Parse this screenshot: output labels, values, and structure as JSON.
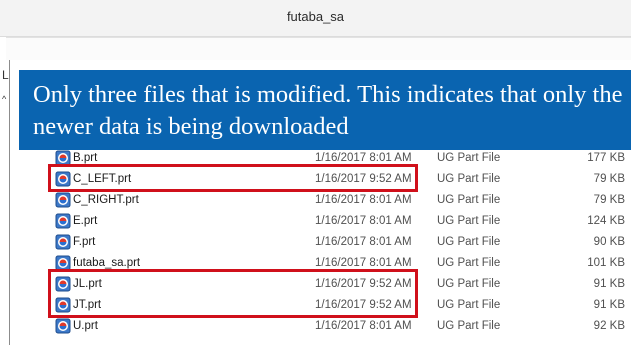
{
  "window": {
    "title": "futaba_sa"
  },
  "overlay": {
    "text": "Only three files that is modified. This indicates that only the newer data is being downloaded"
  },
  "sidebar_fragment": {
    "letter": "L",
    "caret": "^"
  },
  "files": [
    {
      "name": "B.prt",
      "date": "1/16/2017 8:01 AM",
      "type": "UG Part File",
      "size": "177 KB",
      "icon": "ug-part-icon"
    },
    {
      "name": "C_LEFT.prt",
      "date": "1/16/2017 9:52 AM",
      "type": "UG Part File",
      "size": "79 KB",
      "icon": "ug-part-icon"
    },
    {
      "name": "C_RIGHT.prt",
      "date": "1/16/2017 8:01 AM",
      "type": "UG Part File",
      "size": "79 KB",
      "icon": "ug-part-icon"
    },
    {
      "name": "E.prt",
      "date": "1/16/2017 8:01 AM",
      "type": "UG Part File",
      "size": "124 KB",
      "icon": "ug-part-icon"
    },
    {
      "name": "F.prt",
      "date": "1/16/2017 8:01 AM",
      "type": "UG Part File",
      "size": "90 KB",
      "icon": "ug-part-icon"
    },
    {
      "name": "futaba_sa.prt",
      "date": "1/16/2017 8:01 AM",
      "type": "UG Part File",
      "size": "101 KB",
      "icon": "ug-part-icon"
    },
    {
      "name": "JL.prt",
      "date": "1/16/2017 9:52 AM",
      "type": "UG Part File",
      "size": "91 KB",
      "icon": "ug-part-icon"
    },
    {
      "name": "JT.prt",
      "date": "1/16/2017 9:52 AM",
      "type": "UG Part File",
      "size": "91 KB",
      "icon": "ug-part-icon"
    },
    {
      "name": "U.prt",
      "date": "1/16/2017 8:01 AM",
      "type": "UG Part File",
      "size": "92 KB",
      "icon": "ug-part-icon"
    }
  ],
  "colors": {
    "highlight": "#d0101b",
    "banner": "#0a64b0"
  }
}
